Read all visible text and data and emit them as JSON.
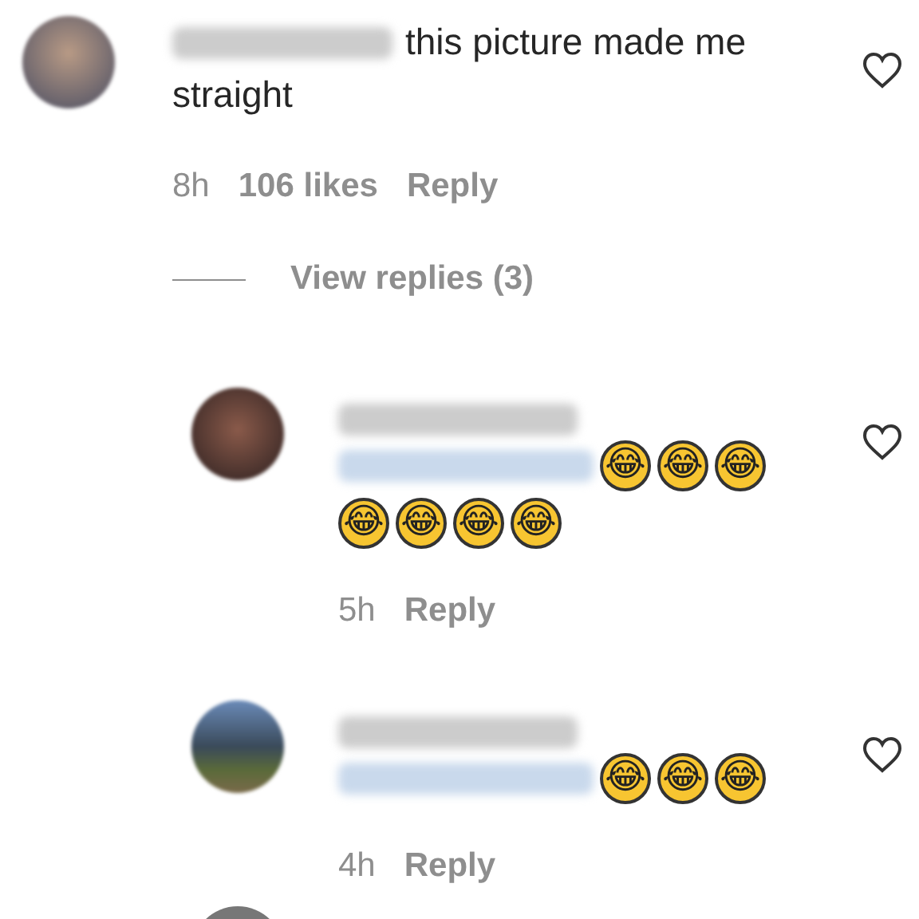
{
  "comment": {
    "text_lines": [
      "this picture made me",
      "straight"
    ],
    "time": "8h",
    "likes": "106 likes",
    "reply": "Reply",
    "liked": false
  },
  "view_replies": "View replies (3)",
  "replies": [
    {
      "emojis": [
        "😂",
        "😂",
        "😂",
        "😂",
        "😂",
        "😂",
        "😂"
      ],
      "time": "5h",
      "reply": "Reply",
      "liked": false
    },
    {
      "emojis": [
        "😂",
        "😂",
        "😂"
      ],
      "time": "4h",
      "reply": "Reply",
      "liked": false
    }
  ]
}
